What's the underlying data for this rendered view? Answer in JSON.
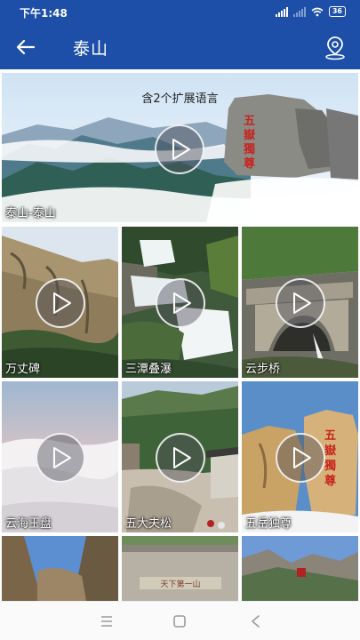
{
  "status_bar": {
    "time": "下午1:48",
    "battery": "36"
  },
  "app_bar": {
    "title": "泰山"
  },
  "banner": {
    "subtitle": "含2个扩展语言",
    "caption": "泰山-泰山"
  },
  "tiles": [
    {
      "caption": "万丈碑"
    },
    {
      "caption": "三潭叠瀑"
    },
    {
      "caption": "云步桥"
    },
    {
      "caption": "云海玉盘"
    },
    {
      "caption": "五大夫松"
    },
    {
      "caption": "五岳独尊"
    }
  ],
  "rock_inscription": "五嶽獨尊",
  "gate_inscription": "天下第一山",
  "icons": [
    "back-arrow-icon",
    "location-pin-icon",
    "play-icon",
    "menu-icon",
    "home-square-icon",
    "back-triangle-icon"
  ]
}
